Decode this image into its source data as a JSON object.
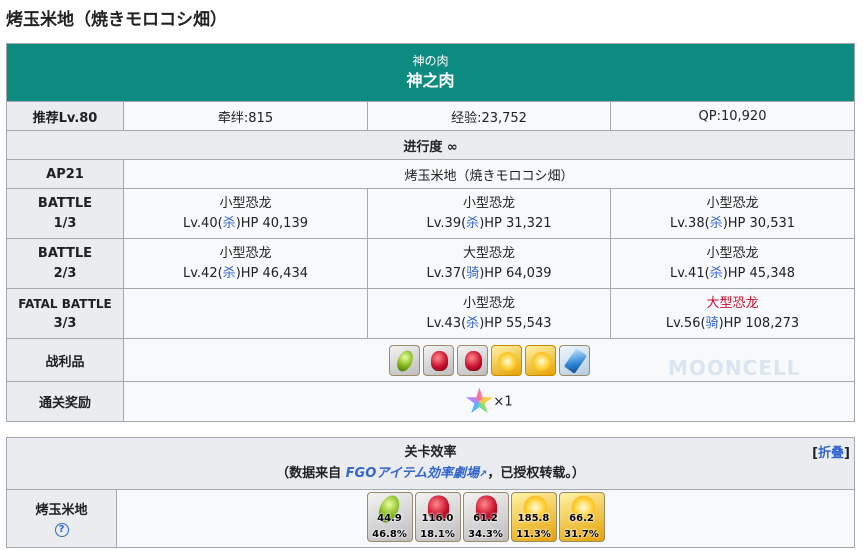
{
  "page_title": "烤玉米地（焼きモロコシ畑）",
  "quest": {
    "name_jp": "神の肉",
    "name_cn": "神之肉",
    "recommend_label": "推荐Lv.80",
    "bond": "牵绊:815",
    "exp": "经验:23,752",
    "qp": "QP:10,920",
    "progress": "进行度 ∞",
    "ap": "AP21",
    "location": "烤玉米地（焼きモロコシ畑）"
  },
  "battles": [
    {
      "label_line1": "BATTLE",
      "label_line2": "1/3",
      "enemies": [
        {
          "name": "小型恐龙",
          "lv": "Lv.40(",
          "cls": "杀",
          "hp": ")HP 40,139"
        },
        {
          "name": "小型恐龙",
          "lv": "Lv.39(",
          "cls": "杀",
          "hp": ")HP 31,321"
        },
        {
          "name": "小型恐龙",
          "lv": "Lv.38(",
          "cls": "杀",
          "hp": ")HP 30,531"
        }
      ]
    },
    {
      "label_line1": "BATTLE",
      "label_line2": "2/3",
      "enemies": [
        {
          "name": "小型恐龙",
          "lv": "Lv.42(",
          "cls": "杀",
          "hp": ")HP 46,434"
        },
        {
          "name": "大型恐龙",
          "lv": "Lv.37(",
          "cls": "骑",
          "hp": ")HP 64,039"
        },
        {
          "name": "小型恐龙",
          "lv": "Lv.41(",
          "cls": "杀",
          "hp": ")HP 45,348"
        }
      ]
    },
    {
      "label_line1": "FATAL BATTLE",
      "label_line2": "3/3",
      "enemies": [
        {
          "name": "",
          "lv": "",
          "cls": "",
          "hp": ""
        },
        {
          "name": "小型恐龙",
          "lv": "Lv.43(",
          "cls": "杀",
          "hp": ")HP 55,543"
        },
        {
          "name": "大型恐龙",
          "lv": "Lv.56(",
          "cls": "骑",
          "hp": ")HP 108,273"
        }
      ]
    }
  ],
  "drops_label": "战利品",
  "drops": [
    {
      "icon": "green-fruit-icon",
      "bg": "silver"
    },
    {
      "icon": "red-gem-icon",
      "bg": "silver"
    },
    {
      "icon": "red-gem-icon",
      "bg": "silver"
    },
    {
      "icon": "gold-gem-icon",
      "bg": "gold"
    },
    {
      "icon": "gold-gem-icon",
      "bg": "gold"
    },
    {
      "icon": "blue-crystal-icon",
      "bg": "blue"
    }
  ],
  "reward_label": "通关奖励",
  "reward_icon": "saint-quartz-icon",
  "reward_count": "×1",
  "watermark": "MOONCELL",
  "efficiency": {
    "title": "关卡效率",
    "source_prefix": "（数据来自 ",
    "source_link": "FGOアイテム効率劇場",
    "source_suffix": "，已授权转载。）",
    "collapse_bracket_open": "[",
    "collapse_label": "折叠",
    "collapse_bracket_close": "]",
    "row_label": "烤玉米地",
    "help": "?",
    "items": [
      {
        "icon": "green-fruit-icon",
        "bg": "silver",
        "ap": "44.9",
        "rate": "46.8%"
      },
      {
        "icon": "red-gem-icon",
        "bg": "silver",
        "ap": "116.0",
        "rate": "18.1%"
      },
      {
        "icon": "red-gem-icon",
        "bg": "silver",
        "ap": "61.2",
        "rate": "34.3%"
      },
      {
        "icon": "gold-gem-icon",
        "bg": "gold",
        "ap": "185.8",
        "rate": "11.3%"
      },
      {
        "icon": "gold-gem-icon",
        "bg": "gold",
        "ap": "66.2",
        "rate": "31.7%"
      }
    ]
  },
  "colors": {
    "header_teal": "#0d8b80",
    "label_bg": "#eaecf0",
    "link_blue": "#3366cc",
    "boss_red": "#c8102e"
  }
}
